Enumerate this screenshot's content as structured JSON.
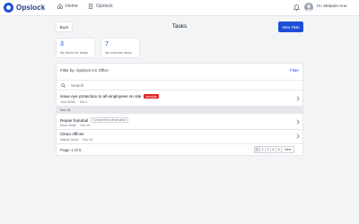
{
  "app": {
    "brand": "Opslock"
  },
  "nav": {
    "home": "Home",
    "opslock": "Opslock"
  },
  "user": {
    "greeting": "Hi, Melanie Ann"
  },
  "header": {
    "back": "Back",
    "title": "Tasks",
    "new_task": "New Task"
  },
  "stats": [
    {
      "value": "3",
      "label": "My items for today"
    },
    {
      "value": "7",
      "label": "My overdue tasks"
    }
  ],
  "filter": {
    "title": "Filter by: Opslock CX Office",
    "link": "Filter"
  },
  "search": {
    "placeholder": "Search"
  },
  "tasks_top": [
    {
      "title": "Issue eye protection to all employees on site",
      "badge": "overdue",
      "assignee": "John Smith",
      "date": "Dec 1"
    }
  ],
  "date_group": "Nov 15",
  "tasks_group": [
    {
      "title": "Repair handrail",
      "badge": "Created from observation",
      "assignee": "Anna Smith",
      "date": "Nov 15"
    },
    {
      "title": "Clean offices",
      "assignee": "Nathan Smith",
      "date": "Nov 15"
    }
  ],
  "pagination": {
    "info": "Page 1 of 5",
    "pages": [
      "1",
      "2",
      "3",
      "4",
      "5"
    ],
    "next": "Next"
  },
  "colors": {
    "accent": "#1d4ed8",
    "danger": "#dc2626"
  }
}
